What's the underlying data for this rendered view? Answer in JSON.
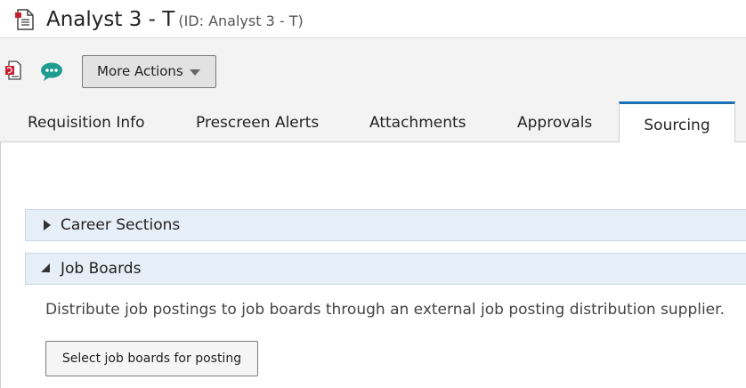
{
  "header": {
    "title": "Analyst 3 - T",
    "id_text": "(ID: Analyst 3 - T)",
    "doc_icon": "document-icon"
  },
  "toolbar": {
    "pdf_icon": "pdf-icon",
    "chat_icon": "chat-bubble-icon",
    "more_actions_label": "More Actions",
    "more_actions_icon": "caret-down-icon"
  },
  "tabs": [
    {
      "label": "Requisition Info",
      "active": false
    },
    {
      "label": "Prescreen Alerts",
      "active": false
    },
    {
      "label": "Attachments",
      "active": false
    },
    {
      "label": "Approvals",
      "active": false
    },
    {
      "label": "Sourcing",
      "active": true
    }
  ],
  "sections": [
    {
      "label": "Career Sections",
      "expanded": false
    },
    {
      "label": "Job Boards",
      "expanded": true,
      "description": "Distribute job postings to job boards through an external job posting distribution supplier.",
      "button_label": "Select job boards for posting"
    }
  ],
  "colors": {
    "accent": "#1a6fb5",
    "section_bg": "#e6eef8",
    "chat_icon": "#1f9b8f",
    "pdf_red": "#c8202f"
  }
}
